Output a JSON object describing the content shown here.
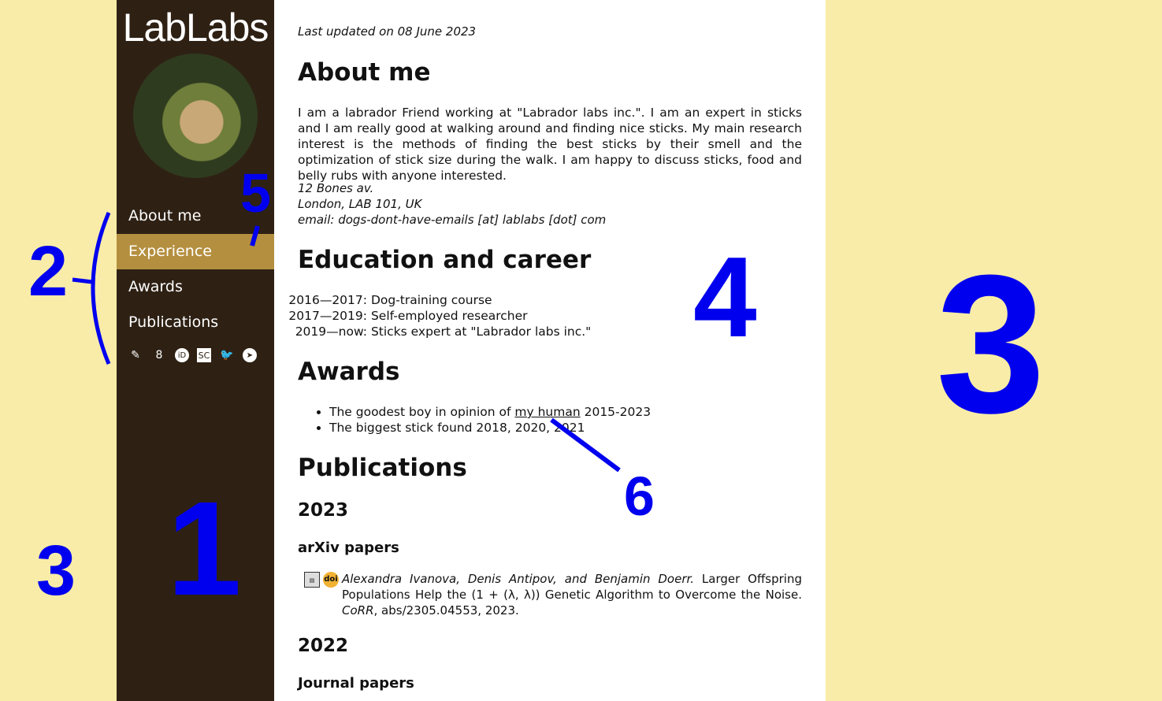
{
  "sidebar": {
    "logo": "LabLabs",
    "nav": [
      {
        "label": "About me",
        "active": false
      },
      {
        "label": "Experience",
        "active": true
      },
      {
        "label": "Awards",
        "active": false
      },
      {
        "label": "Publications",
        "active": false
      }
    ],
    "social": [
      "dblp-icon",
      "google-scholar-icon",
      "orcid-icon",
      "semantic-scholar-icon",
      "twitter-icon",
      "telegram-icon"
    ],
    "social_glyphs": [
      "✎",
      "8",
      "iD",
      "SC",
      "🐦",
      "➤"
    ]
  },
  "main": {
    "updated": "Last updated on 08 June 2023",
    "about": {
      "title": "About me",
      "text": "I am a labrador Friend working at \"Labrador labs inc.\". I am an expert in sticks and I am really good at walking around and finding nice sticks. My main research interest is the methods of finding the best sticks by their smell and the optimization of stick size during the walk. I am happy to discuss sticks, food and belly rubs with anyone interested.",
      "address": [
        "12 Bones av.",
        "London, LAB 101, UK",
        "email: dogs-dont-have-emails [at] lablabs [dot] com"
      ]
    },
    "education": {
      "title": "Education and career",
      "rows": [
        {
          "years": "2016—2017:",
          "desc": "Dog-training course"
        },
        {
          "years": "2017—2019:",
          "desc": "Self-employed researcher"
        },
        {
          "years": "2019—now:",
          "desc": "Sticks expert at \"Labrador labs inc.\""
        }
      ]
    },
    "awards": {
      "title": "Awards",
      "items": [
        {
          "pre": "The goodest boy in opinion of",
          "link": "my human",
          "post": "2015-2023"
        },
        {
          "pre": "The biggest stick found 2018, 2020, 2021",
          "link": "",
          "post": ""
        }
      ]
    },
    "publications": {
      "title": "Publications",
      "year1": "2023",
      "sub1": "arXiv papers",
      "pub1": {
        "authors": "Alexandra Ivanova, Denis Antipov, and Benjamin Doerr.",
        "title": "Larger Offspring Populations Help the (1 + (λ, λ)) Genetic Algorithm to Overcome the Noise.",
        "venue": "CoRR",
        "rest": ", abs/2305.04553, 2023."
      },
      "year2": "2022",
      "sub2": "Journal papers"
    }
  },
  "annotations": [
    "1",
    "2",
    "3",
    "3",
    "4",
    "5",
    "6"
  ],
  "colors": {
    "sidebar_bg": "#2e2114",
    "active_nav": "#b48f3f",
    "page_bg": "#f8eca8",
    "annotation": "#0000ee"
  }
}
